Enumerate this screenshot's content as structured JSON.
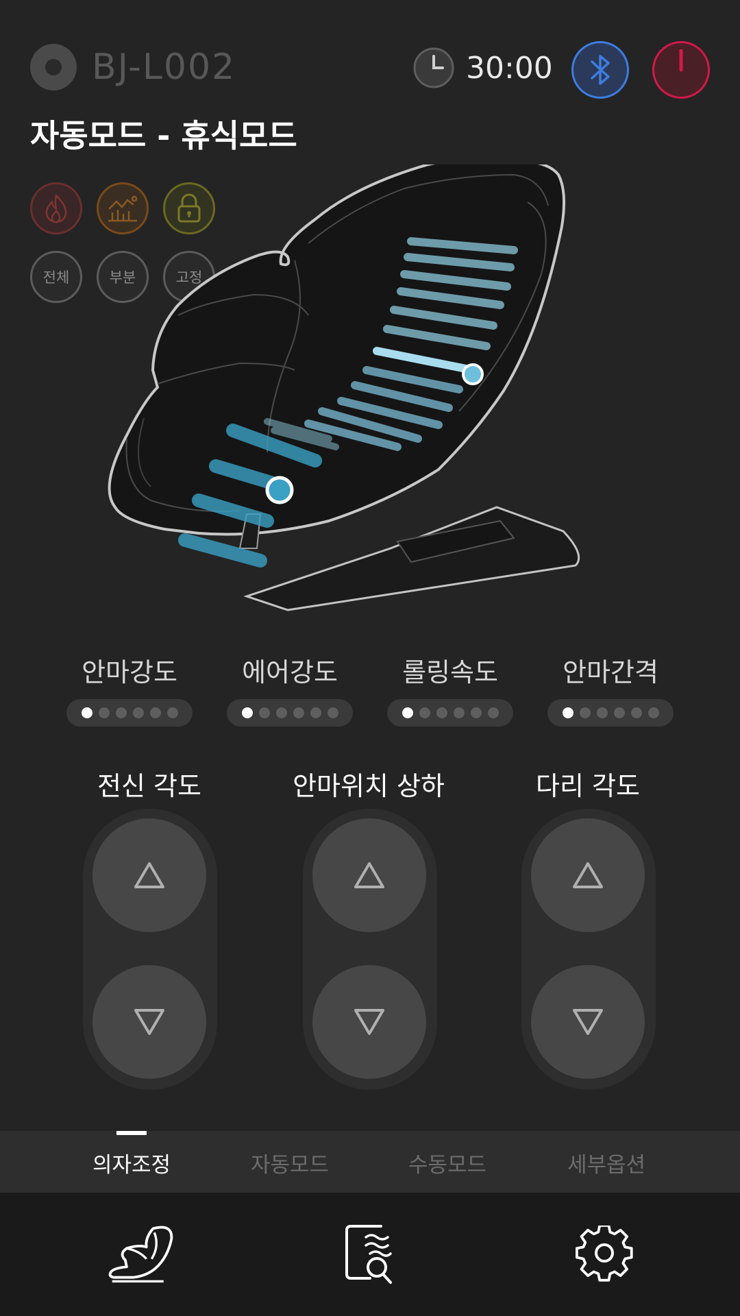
{
  "header": {
    "model_name": "BJ-L002",
    "timer": "30:00"
  },
  "mode_title": "자동모드 - 휴식모드",
  "chips": {
    "all": "전체",
    "part": "부분",
    "fixed": "고정"
  },
  "sliders": [
    {
      "label": "안마강도",
      "level": 1,
      "max": 6
    },
    {
      "label": "에어강도",
      "level": 1,
      "max": 6
    },
    {
      "label": "롤링속도",
      "level": 1,
      "max": 6
    },
    {
      "label": "안마간격",
      "level": 1,
      "max": 6
    }
  ],
  "adjust": [
    {
      "label": "전신 각도"
    },
    {
      "label": "안마위치 상하"
    },
    {
      "label": "다리 각도"
    }
  ],
  "tabs": [
    {
      "label": "의자조정",
      "active": true
    },
    {
      "label": "자동모드",
      "active": false
    },
    {
      "label": "수동모드",
      "active": false
    },
    {
      "label": "세부옵션",
      "active": false
    }
  ],
  "icons": {
    "logo": "logo-circle-icon",
    "timer": "clock-icon",
    "bluetooth": "bluetooth-icon",
    "power": "power-icon",
    "heat": "flame-icon",
    "chart": "chart-icon",
    "lock": "lock-icon",
    "nav_chair": "massage-chair-icon",
    "nav_search": "search-document-icon",
    "nav_settings": "gear-icon"
  },
  "colors": {
    "background": "#242424",
    "bluetooth": "#3d7de0",
    "power": "#d2194a",
    "massage_band_light": "#8cc8dc",
    "massage_band_dark": "#3aa0c4"
  }
}
